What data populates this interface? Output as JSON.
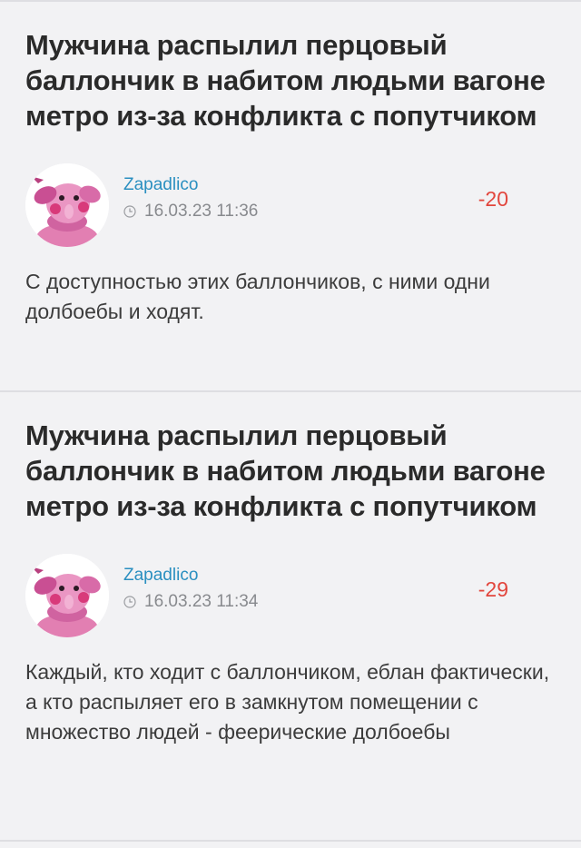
{
  "comments": [
    {
      "article_title": "Мужчина распылил перцовый баллончик в набитом людьми вагоне метро из-за конфликта с попутчиком",
      "author": "Zapadlico",
      "time": "16.03.23 11:36",
      "score": "-20",
      "text": "С доступностью этих баллончиков, с ними одни долбоебы и ходят."
    },
    {
      "article_title": "Мужчина распылил перцовый баллончик в набитом людьми вагоне метро из-за конфликта с попутчиком",
      "author": "Zapadlico",
      "time": "16.03.23 11:34",
      "score": "-29",
      "text": "Каждый, кто ходит с баллончиком, еблан фактически, а кто распыляет его в замкнутом помещении с множество людей - феерические долбоебы"
    }
  ],
  "colors": {
    "background": "#f2f2f4",
    "author": "#2a8fc0",
    "score_negative": "#e2463d",
    "title": "#2a2a2a",
    "meta": "#888a8e"
  },
  "icons": {
    "avatar": "pink-elephant-toy-avatar",
    "time": "clock-icon"
  }
}
